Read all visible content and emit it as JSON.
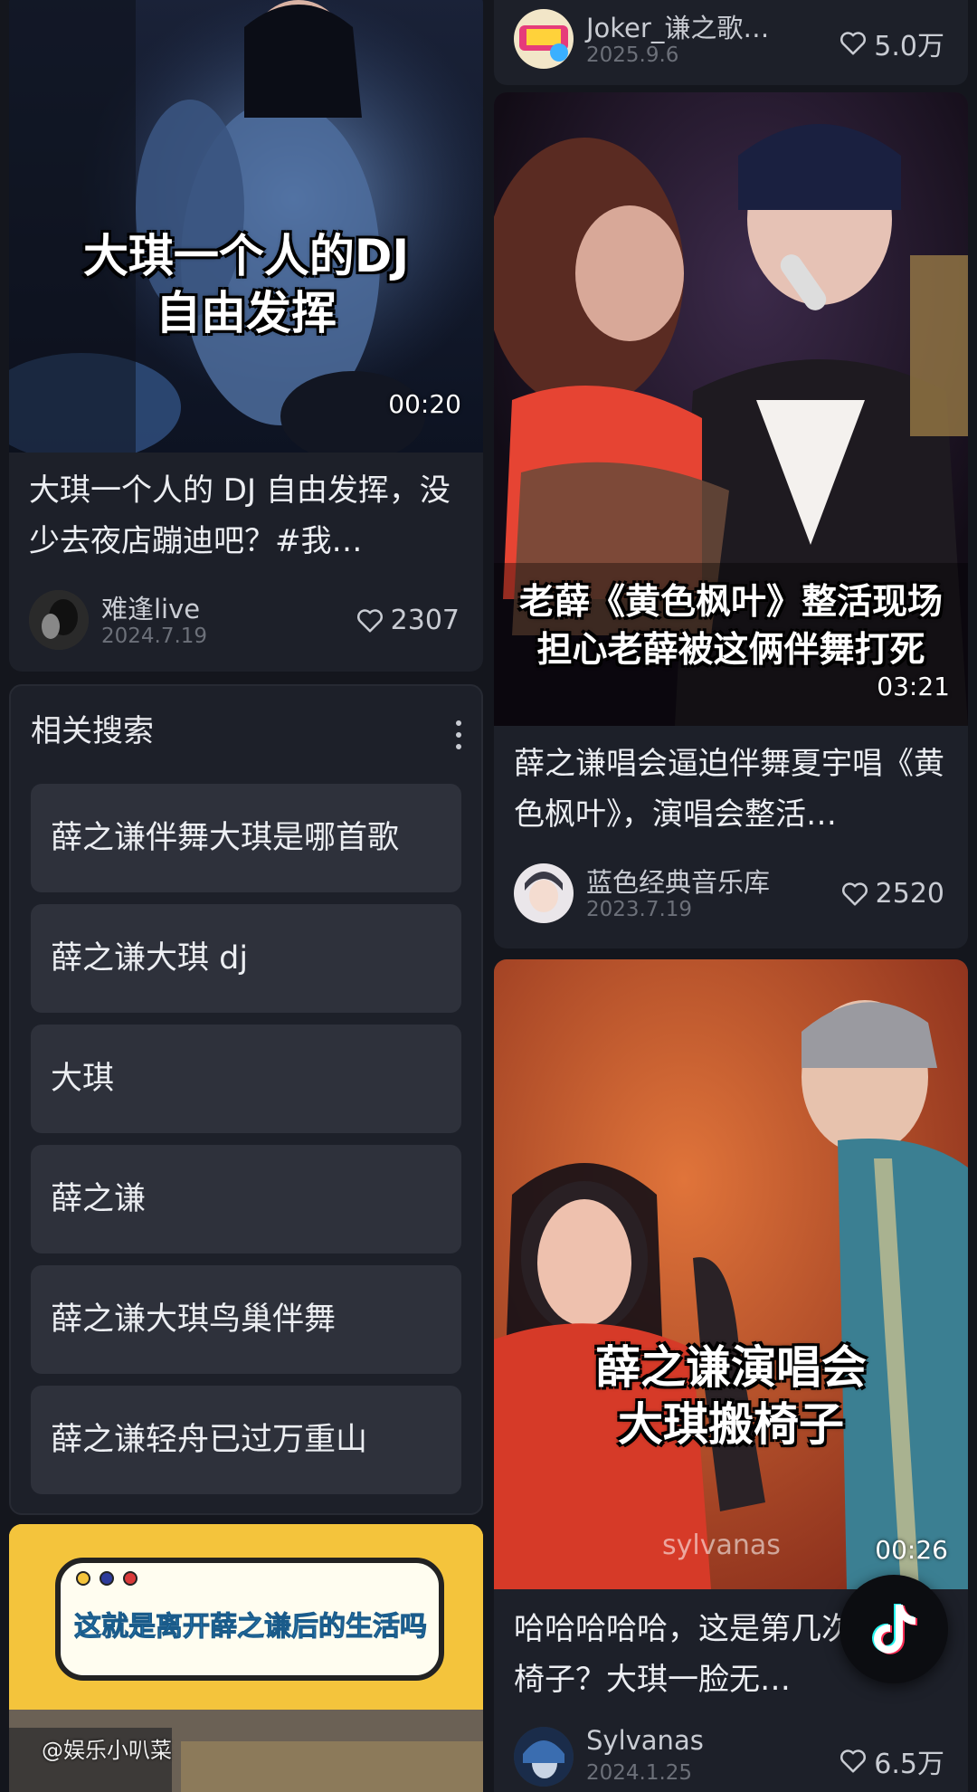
{
  "left_column": {
    "video_card_1": {
      "overlay_caption_line1": "大琪一个人的DJ",
      "overlay_caption_line2": "自由发挥",
      "duration": "00:20",
      "title": "大琪一个人的 DJ 自由发挥，没少去夜店蹦迪吧？#我…",
      "author": "难逢live",
      "date": "2024.7.19",
      "likes": "2307"
    },
    "related_search": {
      "heading": "相关搜索",
      "items": [
        "薛之谦伴舞大琪是哪首歌",
        "薛之谦大琪 dj",
        "大琪",
        "薛之谦",
        "薛之谦大琪鸟巢伴舞",
        "薛之谦轻舟已过万重山"
      ]
    },
    "video_card_2": {
      "overlay_text": "这就是离开薛之谦后的生活吗",
      "watermark": "@娱乐小叭菜"
    }
  },
  "right_column": {
    "top_card": {
      "author": "Joker_谦之歌…",
      "date": "2025.9.6",
      "likes": "5.0万"
    },
    "video_card_1": {
      "overlay_caption_line1": "老薛《黄色枫叶》整活现场",
      "overlay_caption_line2": "担心老薛被这俩伴舞打死",
      "duration": "03:21",
      "title": "薛之谦唱会逼迫伴舞夏宇唱《黄色枫叶》，演唱会整活…",
      "author": "蓝色经典音乐库",
      "date": "2023.7.19",
      "likes": "2520"
    },
    "video_card_2": {
      "overlay_caption_line1": "薛之谦演唱会",
      "overlay_caption_line2": "大琪搬椅子",
      "watermark": "sylvanas",
      "duration": "00:26",
      "title": "哈哈哈哈哈，这是第几次大琪搬椅子？大琪一脸无…",
      "author": "Sylvanas",
      "date": "2024.1.25",
      "likes": "6.5万"
    }
  },
  "colors": {
    "background": "#14161d",
    "card": "#1d2029",
    "chip": "#2e313b",
    "secondary_text": "#6c7079"
  }
}
